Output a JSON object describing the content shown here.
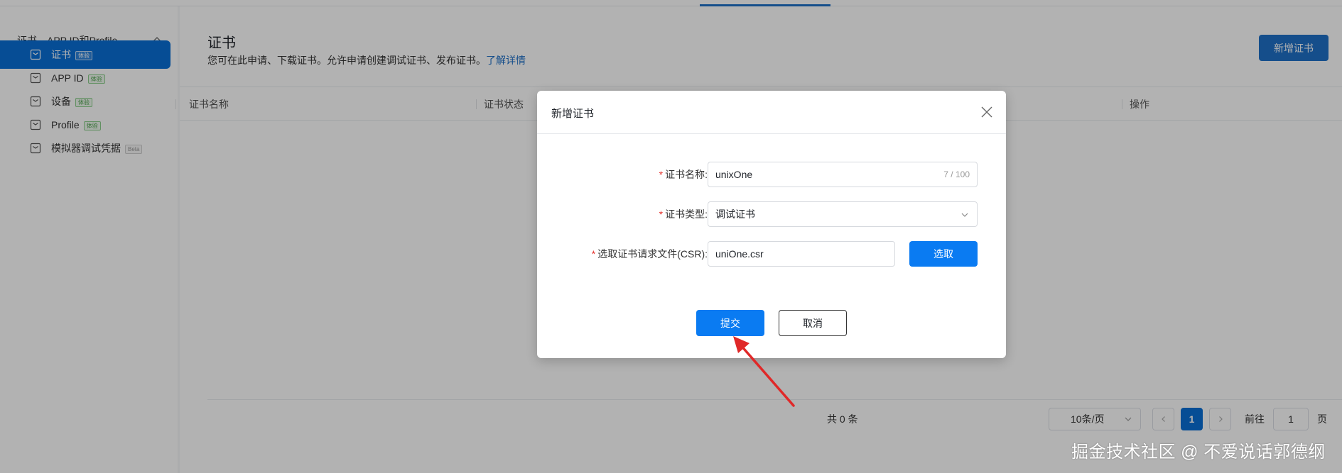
{
  "sidebar": {
    "group_label": "证书、APP ID和Profile",
    "items": [
      {
        "label": "证书",
        "badge": "体验"
      },
      {
        "label": "APP ID",
        "badge": "体验"
      },
      {
        "label": "设备",
        "badge": "体验"
      },
      {
        "label": "Profile",
        "badge": "体验"
      },
      {
        "label": "模拟器调试凭据",
        "badge": "Beta"
      }
    ]
  },
  "header": {
    "title": "证书",
    "desc": "您可在此申请、下载证书。允许申请创建调试证书、发布证书。",
    "learn_more": "了解详情",
    "new_button": "新增证书"
  },
  "table": {
    "columns": [
      "证书名称",
      "证书状态",
      "操作"
    ]
  },
  "pagination": {
    "total": "共 0 条",
    "page_size": "10条/页",
    "current_page": "1",
    "goto_label": "前往",
    "goto_value": "1",
    "page_unit": "页"
  },
  "modal": {
    "title": "新增证书",
    "fields": {
      "name_label": "证书名称:",
      "name_value": "unixOne",
      "name_count": "7 / 100",
      "type_label": "证书类型:",
      "type_value": "调试证书",
      "csr_label": "选取证书请求文件(CSR):",
      "csr_value": "uniOne.csr"
    },
    "required_mark": "*",
    "pick_button": "选取",
    "submit_button": "提交",
    "cancel_button": "取消"
  },
  "watermark": "掘金技术社区 @ 不爱说话郭德纲",
  "colors": {
    "primary": "#0a7bf2",
    "sidebar_active": "#0a6fd6",
    "required": "#e5322d",
    "annotation_arrow": "#e02828"
  }
}
